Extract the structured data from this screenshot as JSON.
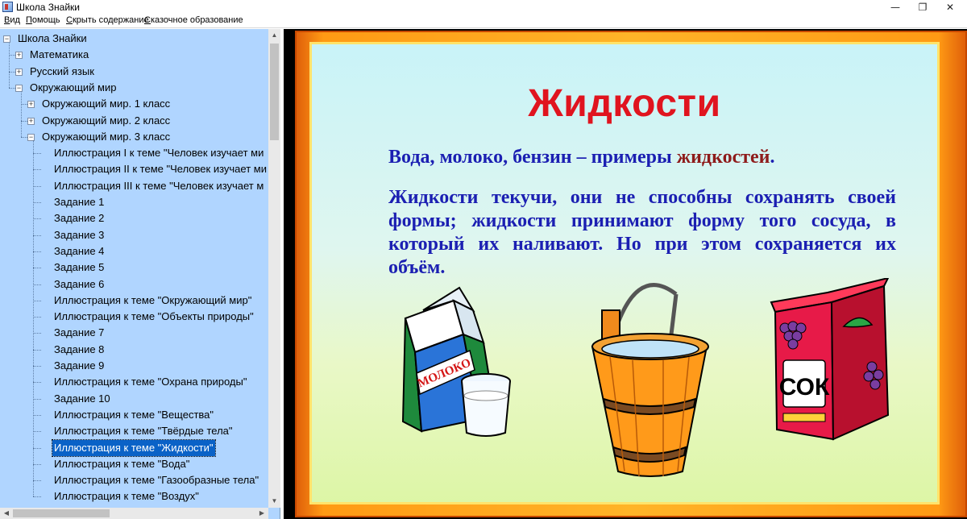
{
  "window": {
    "title": "Школа Знайки",
    "minimize": "—",
    "restore": "❐",
    "close": "✕"
  },
  "menu": [
    "Вид",
    "Помощь",
    "Скрыть содержание",
    "Сказочное образование"
  ],
  "tree": [
    {
      "label": "Школа Знайки",
      "level": 0,
      "expander": "−"
    },
    {
      "label": "Математика",
      "level": 1,
      "expander": "+"
    },
    {
      "label": "Русский язык",
      "level": 1,
      "expander": "+"
    },
    {
      "label": "Окружающий мир",
      "level": 1,
      "expander": "−"
    },
    {
      "label": "Окружающий мир. 1 класс",
      "level": 2,
      "expander": "+"
    },
    {
      "label": "Окружающий мир. 2 класс",
      "level": 2,
      "expander": "+"
    },
    {
      "label": "Окружающий мир. 3 класс",
      "level": 2,
      "expander": "−"
    },
    {
      "label": "Иллюстрация I к теме \"Человек изучает ми",
      "level": 3
    },
    {
      "label": "Иллюстрация II к теме \"Человек изучает ми",
      "level": 3
    },
    {
      "label": "Иллюстрация III к теме \"Человек изучает м",
      "level": 3
    },
    {
      "label": "Задание 1",
      "level": 3
    },
    {
      "label": "Задание 2",
      "level": 3
    },
    {
      "label": "Задание 3",
      "level": 3
    },
    {
      "label": "Задание 4",
      "level": 3
    },
    {
      "label": "Задание 5",
      "level": 3
    },
    {
      "label": "Задание 6",
      "level": 3
    },
    {
      "label": "Иллюстрация к теме \"Окружающий мир\"",
      "level": 3
    },
    {
      "label": "Иллюстрация к теме \"Объекты природы\"",
      "level": 3
    },
    {
      "label": "Задание 7",
      "level": 3
    },
    {
      "label": "Задание 8",
      "level": 3
    },
    {
      "label": "Задание 9",
      "level": 3
    },
    {
      "label": "Иллюстрация к теме \"Охрана природы\"",
      "level": 3
    },
    {
      "label": "Задание 10",
      "level": 3
    },
    {
      "label": "Иллюстрация к теме \"Вещества\"",
      "level": 3
    },
    {
      "label": "Иллюстрация к теме \"Твёрдые тела\"",
      "level": 3
    },
    {
      "label": "Иллюстрация к теме \"Жидкости\"",
      "level": 3,
      "selected": true
    },
    {
      "label": "Иллюстрация к теме \"Вода\"",
      "level": 3
    },
    {
      "label": "Иллюстрация к теме \"Газообразные тела\"",
      "level": 3
    },
    {
      "label": "Иллюстрация к теме \"Воздух\"",
      "level": 3
    }
  ],
  "slide": {
    "title": "Жидкости",
    "line1_main": "Вода, молоко, бензин – примеры ",
    "line1_highlight": "жидкостей",
    "line1_end": ".",
    "paragraph": "Жидкости текучи, они не способны сохранять своей формы; жидкости принимают форму того сосуда, в который их наливают. Но при этом сохраняется их объём.",
    "milk_label": "МОЛОКО",
    "juice_label": "СОК",
    "colors": {
      "title": "#e0141f",
      "text": "#1b1fb2",
      "highlight": "#8e1b1b",
      "frame": "#ff9a14"
    }
  }
}
